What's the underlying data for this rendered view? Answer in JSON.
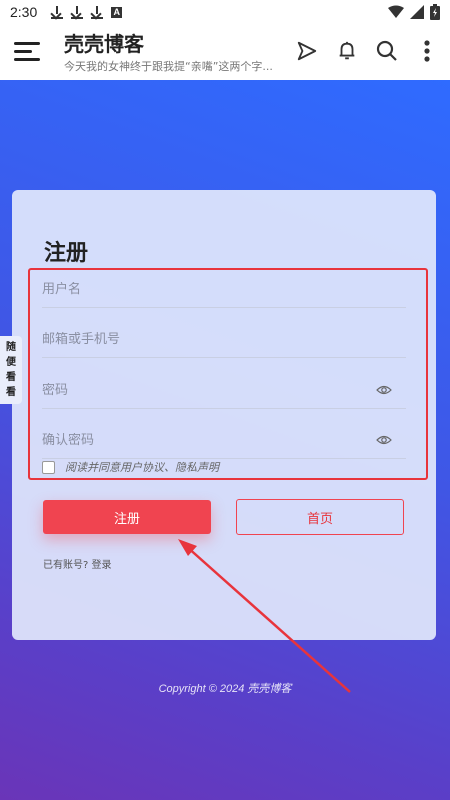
{
  "status_bar": {
    "time": "2:30",
    "notification_icons": [
      "download-icon",
      "download-icon",
      "download-icon",
      "accessibility-icon"
    ],
    "a_glyph": "A"
  },
  "header": {
    "title": "壳壳博客",
    "subtitle": "今天我的女神终于跟我提“亲嘴”这两个字..."
  },
  "side_tab": {
    "chars": [
      "随",
      "便",
      "看",
      "看"
    ]
  },
  "form": {
    "title": "注册",
    "username_placeholder": "用户名",
    "email_placeholder": "邮箱或手机号",
    "password_placeholder": "密码",
    "confirm_placeholder": "确认密码",
    "agree_text": "阅读并同意用户协议、隐私声明",
    "register_label": "注册",
    "home_label": "首页",
    "login_text": "已有账号? 登录"
  },
  "footer": {
    "copyright": "Copyright © 2024 壳壳博客"
  },
  "colors": {
    "accent": "#f04450",
    "annotation": "#e8343c",
    "gradient_top": "#2f6bff",
    "gradient_bottom": "#6a35b8"
  }
}
